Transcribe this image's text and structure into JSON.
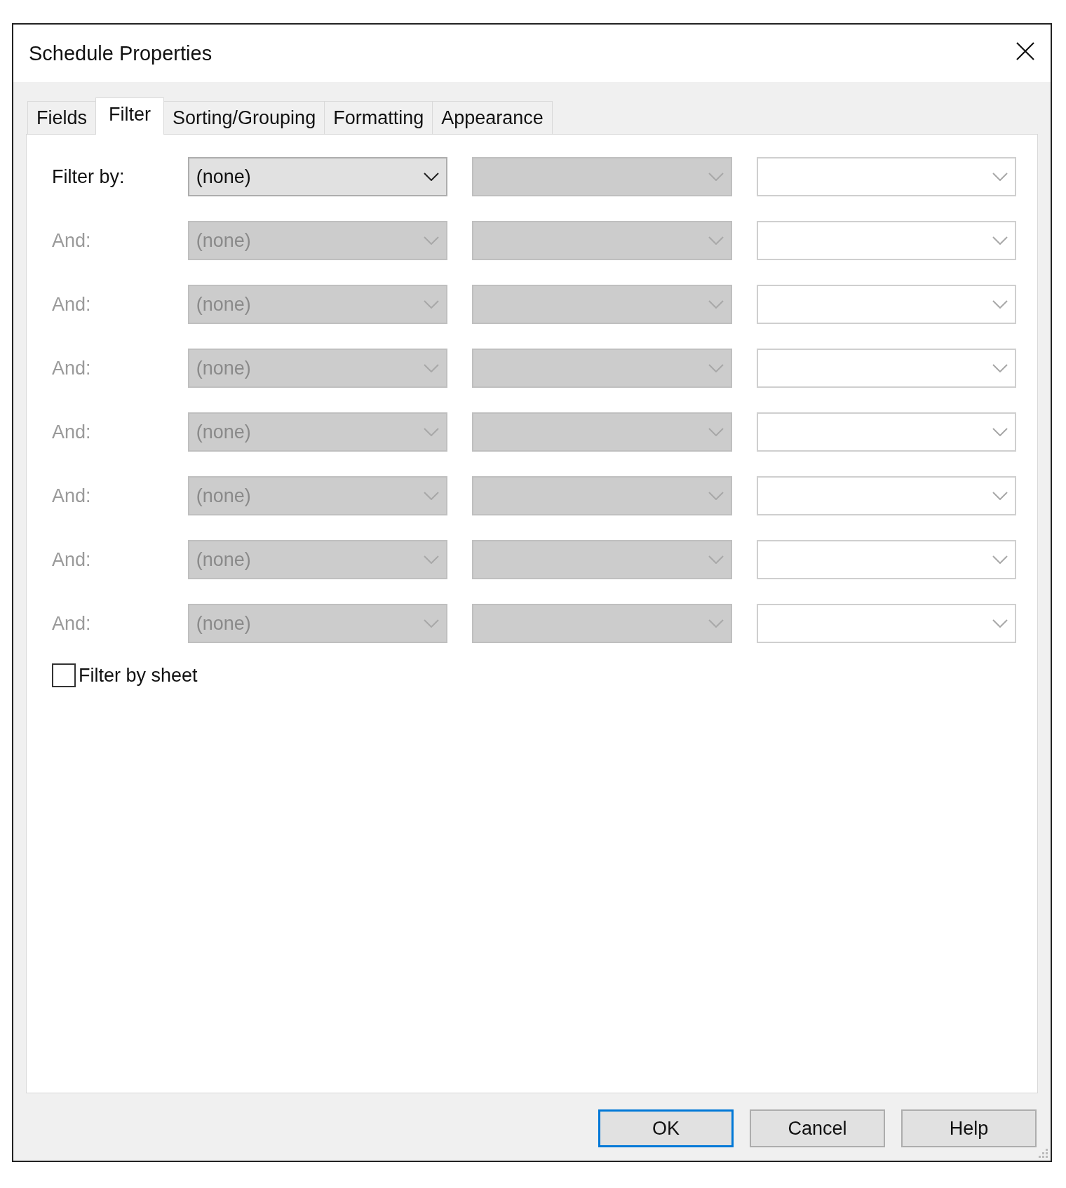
{
  "window": {
    "title": "Schedule Properties"
  },
  "tabs": [
    {
      "label": "Fields",
      "selected": false
    },
    {
      "label": "Filter",
      "selected": true
    },
    {
      "label": "Sorting/Grouping",
      "selected": false
    },
    {
      "label": "Formatting",
      "selected": false
    },
    {
      "label": "Appearance",
      "selected": false
    }
  ],
  "filter_rows": [
    {
      "label": "Filter by:",
      "disabled": false,
      "field": "(none)",
      "operator_disabled": true,
      "value_disabled": false
    },
    {
      "label": "And:",
      "disabled": true,
      "field": "(none)",
      "operator_disabled": true,
      "value_disabled": false
    },
    {
      "label": "And:",
      "disabled": true,
      "field": "(none)",
      "operator_disabled": true,
      "value_disabled": false
    },
    {
      "label": "And:",
      "disabled": true,
      "field": "(none)",
      "operator_disabled": true,
      "value_disabled": false
    },
    {
      "label": "And:",
      "disabled": true,
      "field": "(none)",
      "operator_disabled": true,
      "value_disabled": false
    },
    {
      "label": "And:",
      "disabled": true,
      "field": "(none)",
      "operator_disabled": true,
      "value_disabled": false
    },
    {
      "label": "And:",
      "disabled": true,
      "field": "(none)",
      "operator_disabled": true,
      "value_disabled": false
    },
    {
      "label": "And:",
      "disabled": true,
      "field": "(none)",
      "operator_disabled": true,
      "value_disabled": false
    }
  ],
  "filter_by_sheet": {
    "label": "Filter by sheet",
    "checked": false
  },
  "buttons": [
    {
      "label": "OK",
      "default": true
    },
    {
      "label": "Cancel",
      "default": false
    },
    {
      "label": "Help",
      "default": false
    }
  ]
}
